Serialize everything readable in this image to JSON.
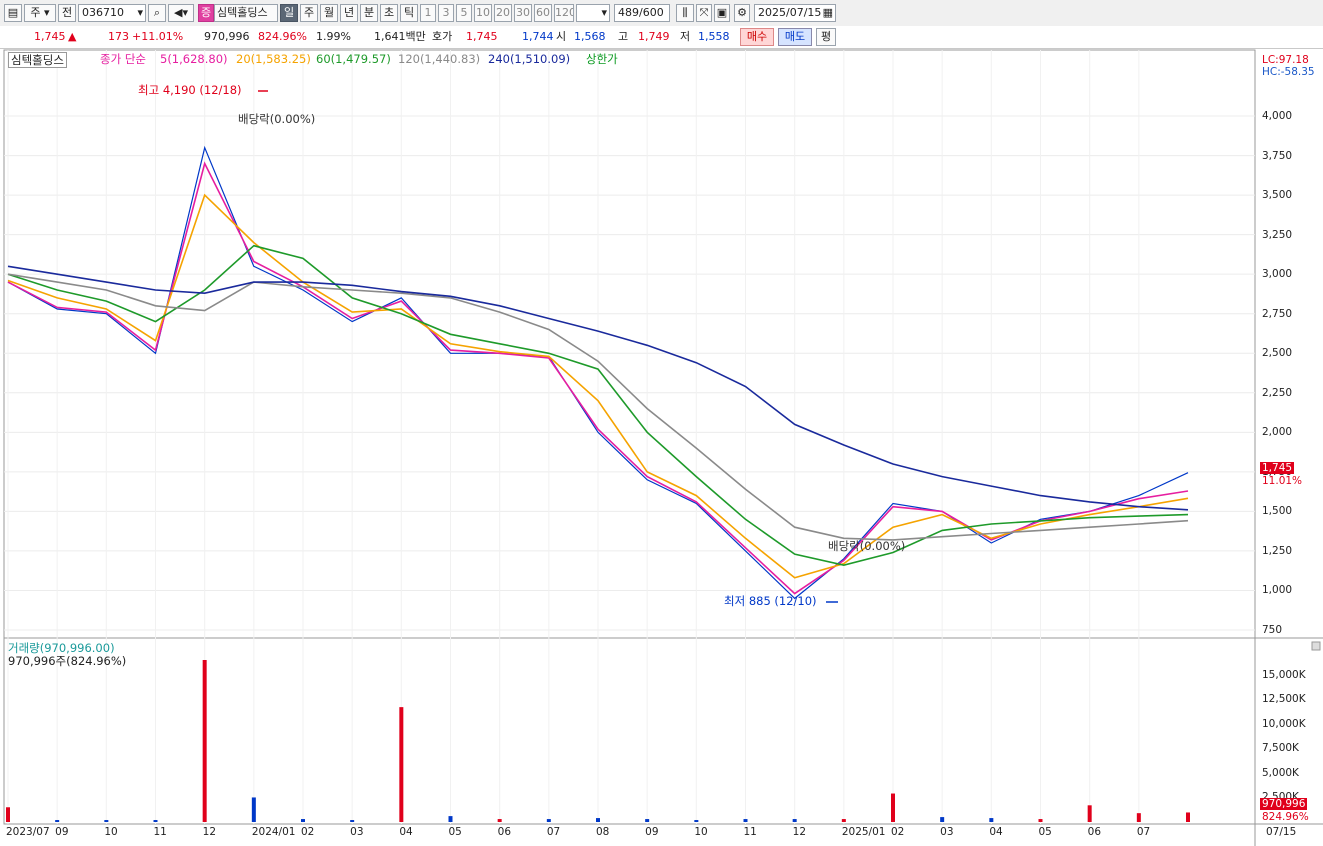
{
  "toolbar": {
    "market": "주",
    "prefix_btn": "전",
    "code": "036710",
    "stock_badge": "증",
    "stock_name": "심텍홀딩스",
    "periods": [
      "일",
      "주",
      "월",
      "년",
      "분",
      "초",
      "틱"
    ],
    "selected_period": "일",
    "intervals": [
      "1",
      "3",
      "5",
      "10",
      "20",
      "30",
      "60",
      "120"
    ],
    "bar_count": "489",
    "bar_total": "/600",
    "date": "2025/07/15"
  },
  "quote": {
    "price": "1,745",
    "arrow": "▲",
    "change": "173",
    "change_pct": "+11.01%",
    "volume": "970,996",
    "volume_ratio": "824.96%",
    "turnover_pct": "1.99%",
    "amount": "1,641백만",
    "bid_label": "호가",
    "ask": "1,745",
    "bid": "1,744",
    "open_label": "시",
    "open": "1,568",
    "high_label": "고",
    "high": "1,749",
    "low_label": "저",
    "low": "1,558",
    "buy_button": "매수",
    "sell_button": "매도",
    "eval_button": "평"
  },
  "legend": {
    "name": "심텍홀딩스",
    "ma_type": "종가 단순",
    "ma5": "5(1,628.80)",
    "ma20": "20(1,583.25)",
    "ma60": "60(1,479.57)",
    "ma120": "120(1,440.83)",
    "ma240": "240(1,510.09)",
    "limit_up": "상한가"
  },
  "price_panel": {
    "lc": "LC:97.18",
    "hc": "HC:-58.35",
    "y_ticks": [
      "4,000",
      "3,750",
      "3,500",
      "3,250",
      "3,000",
      "2,750",
      "2,500",
      "2,250",
      "2,000",
      "1,750",
      "1,500",
      "1,250",
      "1,000",
      "750"
    ],
    "last_price_tag": "1,745",
    "last_pct_tag": "11.01%",
    "high_note": "최고 4,190 (12/18)",
    "low_note": "최저 885 (12/10)",
    "dividend_note_1": "배당락(0.00%)",
    "dividend_note_2": "배당락(0.00%)"
  },
  "volume_panel": {
    "title": "거래량(970,996.00)",
    "sub": "970,996주(824.96%)",
    "y_ticks": [
      "15,000K",
      "12,500K",
      "10,000K",
      "7,500K",
      "5,000K",
      "2,500K"
    ],
    "last_vol_tag": "970,996",
    "last_ratio_tag": "824.96%"
  },
  "x_axis": {
    "labels": [
      "2023/07",
      "09",
      "10",
      "11",
      "12",
      "2024/01",
      "02",
      "03",
      "04",
      "05",
      "06",
      "07",
      "08",
      "09",
      "10",
      "11",
      "12",
      "2025/01",
      "02",
      "03",
      "04",
      "05",
      "06",
      "07"
    ],
    "last_date": "07/15"
  },
  "colors": {
    "up": "#e0001b",
    "down": "#0038c8",
    "ma5": "#e61ea0",
    "ma20": "#f5a300",
    "ma60": "#1e9a2a",
    "ma120": "#8a8a8a",
    "ma240": "#1a2a9c",
    "limit_up": "#0a9a20"
  },
  "chart_data": {
    "type": "line",
    "title": "",
    "y_range": [
      750,
      4190
    ],
    "x": [
      "2023/07",
      "09",
      "10",
      "11",
      "12",
      "2024/01",
      "02",
      "03",
      "04",
      "05",
      "06",
      "07",
      "08",
      "09",
      "10",
      "11",
      "12",
      "2025/01",
      "02",
      "03",
      "04",
      "05",
      "06",
      "07",
      "07/15"
    ],
    "series": [
      {
        "name": "종가",
        "values": [
          2950,
          2780,
          2750,
          2500,
          3800,
          3050,
          2900,
          2700,
          2850,
          2500,
          2500,
          2480,
          2000,
          1700,
          1550,
          1250,
          950,
          1200,
          1550,
          1500,
          1300,
          1450,
          1500,
          1600,
          1745
        ]
      },
      {
        "name": "5(1,628.80)",
        "values": [
          2950,
          2790,
          2760,
          2520,
          3700,
          3080,
          2920,
          2720,
          2830,
          2520,
          2500,
          2470,
          2020,
          1720,
          1560,
          1270,
          980,
          1190,
          1530,
          1500,
          1320,
          1440,
          1500,
          1580,
          1629
        ]
      },
      {
        "name": "20(1,583.25)",
        "values": [
          2960,
          2850,
          2780,
          2580,
          3500,
          3200,
          2950,
          2760,
          2780,
          2560,
          2510,
          2480,
          2200,
          1750,
          1600,
          1330,
          1080,
          1170,
          1400,
          1480,
          1330,
          1420,
          1480,
          1530,
          1583
        ]
      },
      {
        "name": "60(1,479.57)",
        "values": [
          3000,
          2900,
          2830,
          2700,
          2900,
          3180,
          3100,
          2850,
          2750,
          2620,
          2560,
          2500,
          2400,
          2000,
          1720,
          1450,
          1230,
          1160,
          1240,
          1380,
          1420,
          1440,
          1460,
          1470,
          1480
        ]
      },
      {
        "name": "120(1,440.83)",
        "values": [
          3000,
          2950,
          2900,
          2800,
          2770,
          2950,
          2920,
          2900,
          2880,
          2850,
          2760,
          2650,
          2450,
          2150,
          1900,
          1640,
          1400,
          1330,
          1320,
          1340,
          1360,
          1380,
          1400,
          1420,
          1441
        ]
      },
      {
        "name": "240(1,510.09)",
        "values": [
          3050,
          3000,
          2950,
          2900,
          2880,
          2950,
          2950,
          2930,
          2890,
          2860,
          2800,
          2720,
          2640,
          2550,
          2440,
          2290,
          2050,
          1920,
          1800,
          1720,
          1660,
          1600,
          1560,
          1530,
          1510
        ]
      }
    ],
    "volume_K": [
      1500,
      200,
      200,
      200,
      16500,
      2500,
      300,
      200,
      11700,
      600,
      300,
      300,
      400,
      300,
      200,
      300,
      300,
      300,
      2900,
      500,
      400,
      300,
      1700,
      900,
      971
    ],
    "volume_y_range": [
      0,
      16500
    ]
  }
}
